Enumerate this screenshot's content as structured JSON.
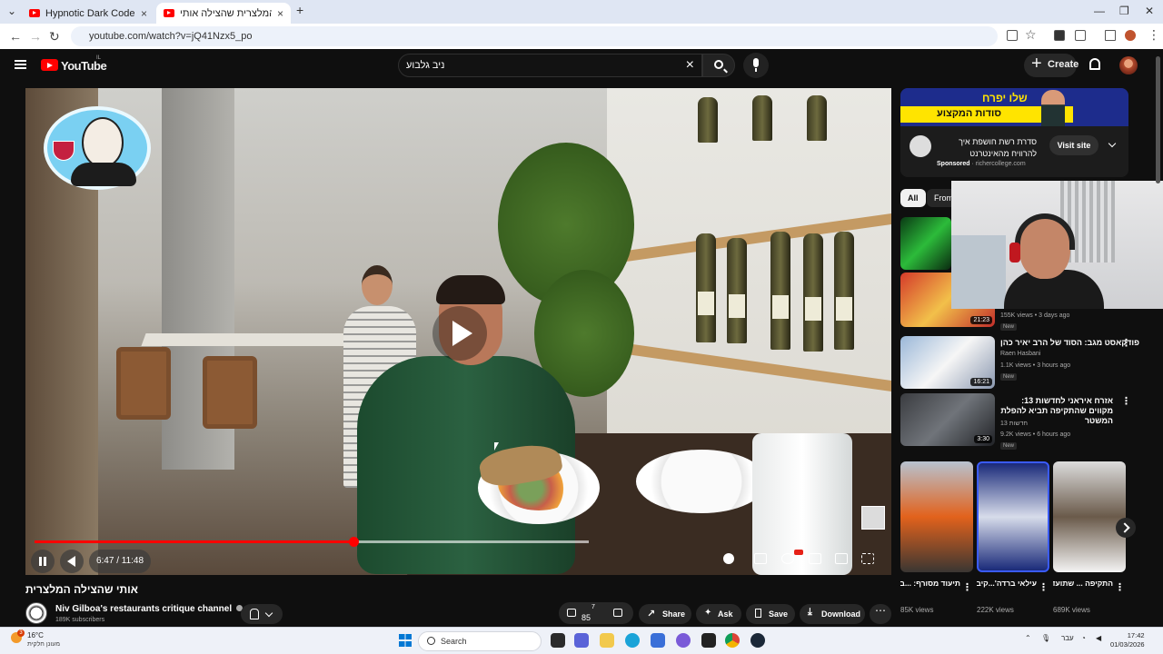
{
  "browser": {
    "tabs": [
      {
        "title": "Hypnotic Dark Code | Futuristic",
        "active": false
      },
      {
        "title": "המלצרית שהצילה אותי - ...",
        "active": true
      }
    ],
    "new_tab": "+",
    "url": "youtube.com/watch?v=jQ41Nzx5_po"
  },
  "youtube": {
    "brand": "YouTube",
    "country": "IL",
    "search_query": "ניב גלבוע",
    "create_label": "Create"
  },
  "player": {
    "current_time": "6:47",
    "duration": "11:48",
    "time_display": "6:47 / 11:48",
    "progress_fraction": 0.575,
    "buffered_fraction": 1.0
  },
  "video": {
    "title": "אותי שהצילה המלצרית",
    "channel": "Niv Gilboa's restaurants critique channel",
    "subscribers": "189K subscribers",
    "likes": "85",
    "likes_sup": "7",
    "share_label": "Share",
    "ask_label": "Ask",
    "save_label": "Save",
    "download_label": "Download"
  },
  "ad": {
    "banner_head": "שלו יפרח",
    "banner_strip": "סודות המקצוע",
    "text": "סדרת רשת חושפת איך להרוויח מהאינטרנט",
    "sponsored": "Sponsored",
    "domain": "richercollege.com",
    "visit_label": "Visit site"
  },
  "chips": {
    "all": "All",
    "from": "From"
  },
  "recommendations": [
    {
      "duration": "21:23",
      "meta": "155K views • 3 days ago",
      "badge": "New"
    },
    {
      "title": "פודקאסט מגב: הסוד של הרב יאיר כהן",
      "channel": "Raen Hasbani",
      "meta": "1.1K views • 3 hours ago",
      "badge": "New",
      "duration": "16:21"
    },
    {
      "title": "אזרח איראני לחדשות 13: מקווים שהתקיפה תביא להפלת המשטר",
      "channel": "חדשות 13",
      "meta": "9.2K views • 6 hours ago",
      "badge": "New",
      "duration": "3:30"
    }
  ],
  "shorts": [
    {
      "title": "תיעוד מסורף: ...ברר ירוש נפל",
      "views": "85K views"
    },
    {
      "title": "עילאי ברדה'...קיבל בתקופה",
      "views": "222K views"
    },
    {
      "title": "התקיפה ... שתועדה",
      "views": "689K views"
    }
  ],
  "taskbar": {
    "temp": "16°C",
    "weather": "מעונן חלקית",
    "search": "Search",
    "lang": "עבר",
    "time": "17:42",
    "date": "01/03/2026",
    "weather_badge": "3"
  },
  "colors": {
    "accent": "#ff0000",
    "bg": "#0f0f0f"
  }
}
